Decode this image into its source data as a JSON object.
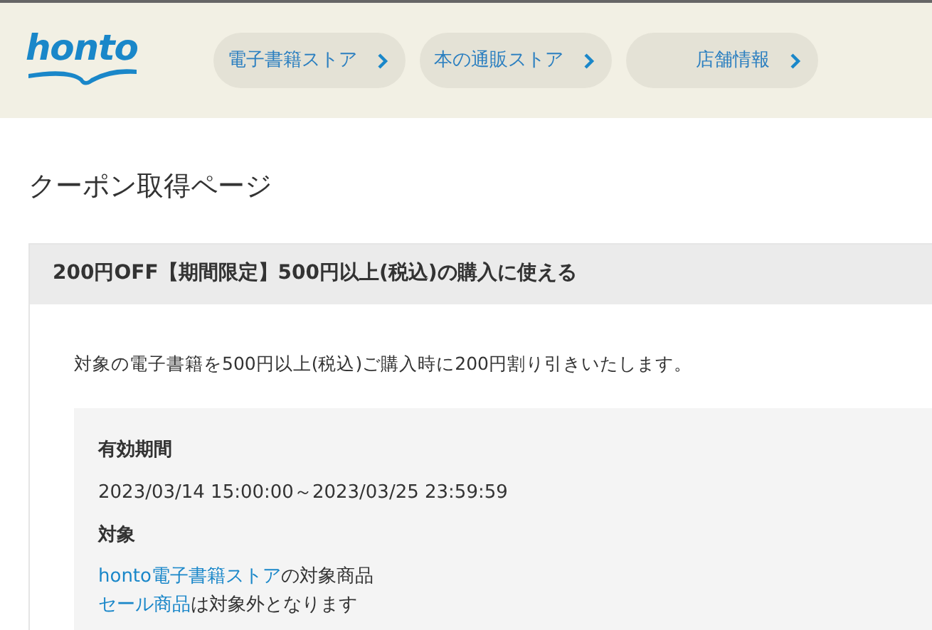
{
  "header": {
    "logo": "honto",
    "nav": [
      {
        "label": "電子書籍ストア"
      },
      {
        "label": "本の通販ストア"
      },
      {
        "label": "店舗情報"
      }
    ]
  },
  "page_title": "クーポン取得ページ",
  "coupon": {
    "title": "200円OFF【期間限定】500円以上(税込)の購入に使える",
    "description": "対象の電子書籍を500円以上(税込)ご購入時に200円割り引きいたします。",
    "details": [
      {
        "kind": "plain",
        "heading": "有効期間",
        "lines": [
          {
            "text": "2023/03/14 15:00:00～2023/03/25 23:59:59"
          }
        ]
      },
      {
        "kind": "links",
        "heading": "対象",
        "lines": [
          {
            "link": "honto電子書籍ストア",
            "text": "の対象商品"
          },
          {
            "link": "セール商品",
            "text": "は対象外となります"
          }
        ]
      }
    ]
  }
}
